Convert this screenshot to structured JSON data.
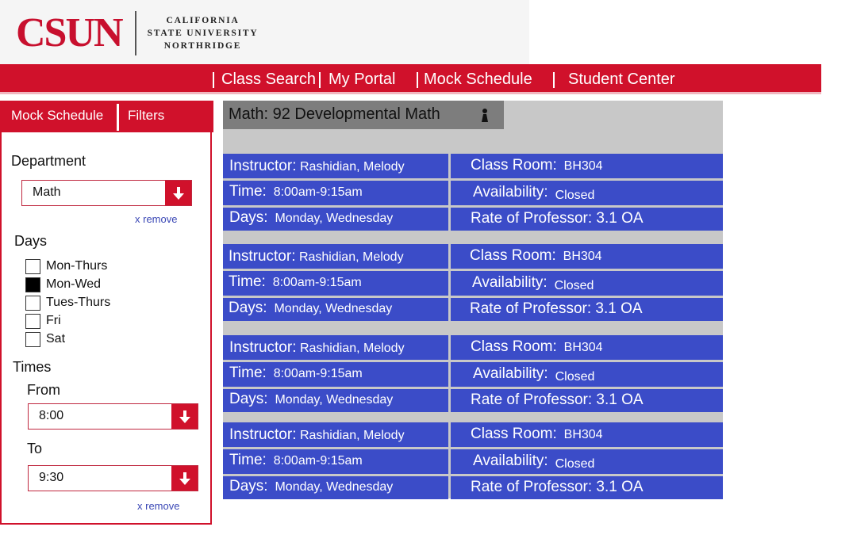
{
  "brand": {
    "logo_text": "CSUN",
    "sub_line1": "CALIFORNIA",
    "sub_line2": "STATE UNIVERSITY",
    "sub_line3": "NORTHRIDGE",
    "accent": "#d0112b",
    "card_blue": "#3b4cc8"
  },
  "nav": {
    "items": [
      "Class Search",
      "My Portal",
      "Mock Schedule",
      "Student Center"
    ]
  },
  "panel": {
    "tabs": [
      "Mock  Schedule",
      "Filters"
    ],
    "department_label": "Department",
    "department_value": "Math",
    "remove_label": "x remove",
    "days_label": "Days",
    "days": [
      {
        "label": "Mon-Thurs",
        "checked": false
      },
      {
        "label": "Mon-Wed",
        "checked": true
      },
      {
        "label": "Tues-Thurs",
        "checked": false
      },
      {
        "label": "Fri",
        "checked": false
      },
      {
        "label": "Sat",
        "checked": false
      }
    ],
    "times_label": "Times",
    "from_label": "From",
    "from_value": "8:00",
    "to_label": "To",
    "to_value": "9:30",
    "icons": {
      "dropdown": "arrow-down-icon"
    }
  },
  "course": {
    "title": "Math: 92 Developmental Math",
    "icon": "person-icon",
    "sections": [
      {
        "instructor_label": "Instructor:",
        "instructor": "Rashidian, Melody",
        "room_label": "Class Room:",
        "room": "BH304",
        "time_label": "Time:",
        "time": "8:00am-9:15am",
        "availability_label": "Availability:",
        "availability": "Closed",
        "days_label": "Days:",
        "days": "Monday, Wednesday",
        "rate": "Rate of Professor: 3.1 OA"
      },
      {
        "instructor_label": "Instructor:",
        "instructor": "Rashidian, Melody",
        "room_label": "Class Room:",
        "room": "BH304",
        "time_label": "Time:",
        "time": "8:00am-9:15am",
        "availability_label": "Availability:",
        "availability": "Closed",
        "days_label": "Days:",
        "days": "Monday, Wednesday",
        "rate": "Rate of Professor: 3.1 OA"
      },
      {
        "instructor_label": "Instructor:",
        "instructor": "Rashidian, Melody",
        "room_label": "Class Room:",
        "room": "BH304",
        "time_label": "Time:",
        "time": "8:00am-9:15am",
        "availability_label": "Availability:",
        "availability": "Closed",
        "days_label": "Days:",
        "days": "Monday, Wednesday",
        "rate": "Rate of Professor: 3.1 OA"
      },
      {
        "instructor_label": "Instructor:",
        "instructor": "Rashidian, Melody",
        "room_label": "Class Room:",
        "room": "BH304",
        "time_label": "Time:",
        "time": "8:00am-9:15am",
        "availability_label": "Availability:",
        "availability": "Closed",
        "days_label": "Days:",
        "days": "Monday, Wednesday",
        "rate": "Rate of Professor: 3.1 OA"
      }
    ]
  }
}
